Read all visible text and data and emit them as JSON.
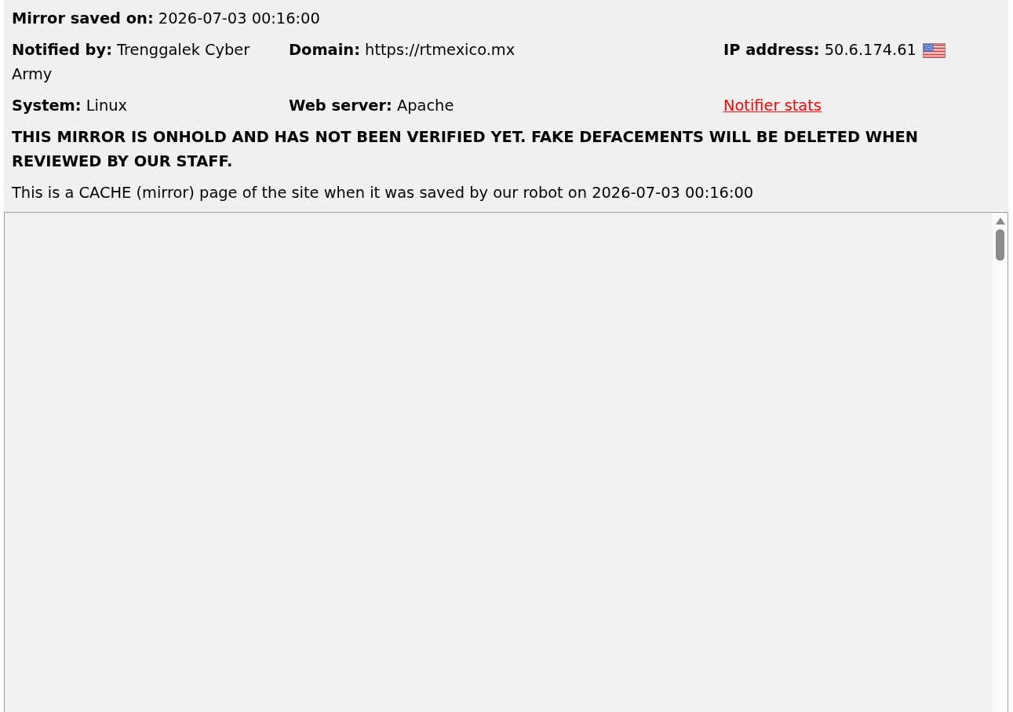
{
  "saved_on": {
    "label": "Mirror saved on:",
    "value": "2026-07-03 00:16:00"
  },
  "rows": [
    {
      "cells": [
        {
          "kind": "field",
          "label": "Notified by:",
          "value": "Trenggalek Cyber Army"
        },
        {
          "kind": "field",
          "label": "Domain:",
          "value": "https://rtmexico.mx"
        },
        {
          "kind": "flagged",
          "label": "IP address:",
          "value": "50.6.174.61"
        }
      ]
    },
    {
      "cells": [
        {
          "kind": "field",
          "label": "System:",
          "value": "Linux"
        },
        {
          "kind": "field",
          "label": "Web server:",
          "value": "Apache"
        },
        {
          "kind": "link",
          "text": "Notifier stats"
        }
      ]
    }
  ],
  "warning": "THIS MIRROR IS ONHOLD AND HAS NOT BEEN VERIFIED YET. FAKE DEFACEMENTS WILL BE DELETED WHEN REVIEWED BY OUR STAFF.",
  "cache_note": "This is a CACHE (mirror) page of the site when it was saved by our robot on 2026-07-03 00:16:00"
}
